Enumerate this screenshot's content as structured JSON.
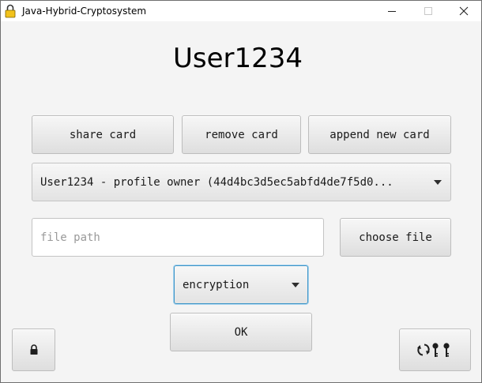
{
  "window": {
    "title": "Java-Hybrid-Cryptosystem",
    "minimize_glyph": "—",
    "maximize_glyph": "☐",
    "close_glyph": "✕"
  },
  "main": {
    "username": "User1234",
    "share_card_label": "share card",
    "remove_card_label": "remove card",
    "append_card_label": "append new card",
    "profile_select_value": "User1234 - profile owner (44d4bc3d5ec5abfd4de7f5d0...",
    "file_path_value": "",
    "file_path_placeholder": "file path",
    "choose_file_label": "choose file",
    "mode_select_value": "encryption",
    "ok_label": "OK"
  },
  "footer": {
    "lock_button_icon": "lock-icon",
    "key_button_icon": "refresh-keys-icon"
  },
  "colors": {
    "window_background": "#f4f4f4",
    "focus_border": "#3e95c8",
    "app_icon_yellow": "#f2c21b"
  }
}
